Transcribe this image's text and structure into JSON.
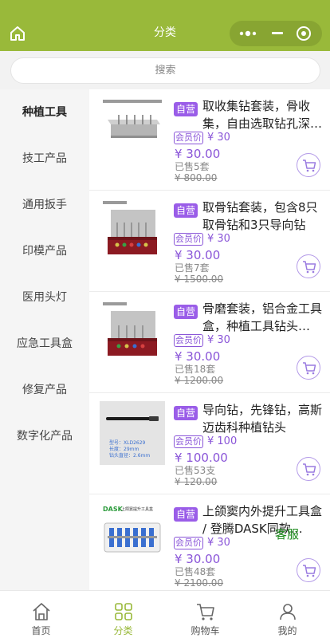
{
  "header": {
    "title": "分类"
  },
  "search": {
    "placeholder": "搜索"
  },
  "sidebar": {
    "items": [
      {
        "label": "种植工具",
        "active": true
      },
      {
        "label": "技工产品"
      },
      {
        "label": "通用扳手"
      },
      {
        "label": "印模产品"
      },
      {
        "label": "医用头灯"
      },
      {
        "label": "应急工具盒"
      },
      {
        "label": "修复产品"
      },
      {
        "label": "数字化产品"
      }
    ]
  },
  "products": [
    {
      "tag": "自营",
      "name": "取收集钻套装，骨收集，自由选取钻孔深…",
      "member_label": "会员价",
      "member_price": "¥ 30",
      "price": "¥ 30.00",
      "sold": "已售5套",
      "original_price": "¥ 800.00"
    },
    {
      "tag": "自营",
      "name": "取骨钻套装，包含8只取骨钻和3只导向钻",
      "member_label": "会员价",
      "member_price": "¥ 30",
      "price": "¥ 30.00",
      "sold": "已售7套",
      "original_price": "¥ 1500.00"
    },
    {
      "tag": "自营",
      "name": "骨磨套装，铝合金工具盒，种植工具钻头…",
      "member_label": "会员价",
      "member_price": "¥ 30",
      "price": "¥ 30.00",
      "sold": "已售18套",
      "original_price": "¥ 1200.00"
    },
    {
      "tag": "自营",
      "name": "导向钻，先锋钻，高斯迈齿科种植钻头",
      "member_label": "会员价",
      "member_price": "¥ 100",
      "price": "¥ 100.00",
      "sold": "已售53支",
      "original_price": "¥ 120.00",
      "image_text": [
        "型号：XLD2629",
        "长度：29mm",
        "钻头直径：2.6mm"
      ]
    },
    {
      "tag": "自营",
      "name": "上颌窦内外提升工具盒 / 登腾DASK同款…",
      "member_label": "会员价",
      "member_price": "¥ 30",
      "price": "¥ 30.00",
      "sold": "已售48套",
      "original_price": "¥ 2100.00",
      "image_text": [
        "DASK",
        "上颌窦提升工具盒"
      ]
    }
  ],
  "service": {
    "label": "客服"
  },
  "tabbar": {
    "items": [
      {
        "label": "首页"
      },
      {
        "label": "分类",
        "active": true
      },
      {
        "label": "购物车"
      },
      {
        "label": "我的"
      }
    ]
  },
  "colors": {
    "brand_green": "#99b93a",
    "accent_purple": "#9a5de8",
    "service_green": "#1b8a1b"
  }
}
